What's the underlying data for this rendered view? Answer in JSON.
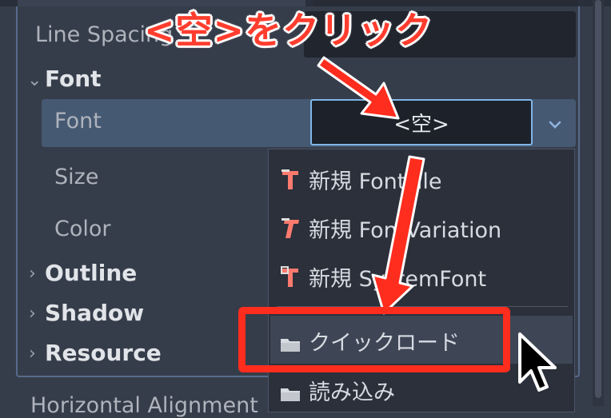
{
  "inspector": {
    "line_spacing_label": "Line Spacing",
    "font_section": "Font",
    "font_label": "Font",
    "font_value": "<空>",
    "size_label": "Size",
    "color_label": "Color",
    "outline_section": "Outline",
    "shadow_section": "Shadow",
    "resource_section": "Resource",
    "horizontal_align_label": "Horizontal Alignment"
  },
  "menu": {
    "items": [
      {
        "label": "新規 FontFile",
        "icon": "font-file-icon"
      },
      {
        "label": "新規 FontVariation",
        "icon": "font-variation-icon"
      },
      {
        "label": "新規 SystemFont",
        "icon": "system-font-icon"
      },
      {
        "label": "クイックロード",
        "icon": "folder-icon"
      },
      {
        "label": "読み込み",
        "icon": "folder-icon"
      }
    ]
  },
  "annotation": {
    "text": "<空>をクリック",
    "color": "#ff2d1e"
  },
  "colors": {
    "background": "#363d4a",
    "selected_row": "#465973",
    "focus_border": "#7fb6e8"
  }
}
